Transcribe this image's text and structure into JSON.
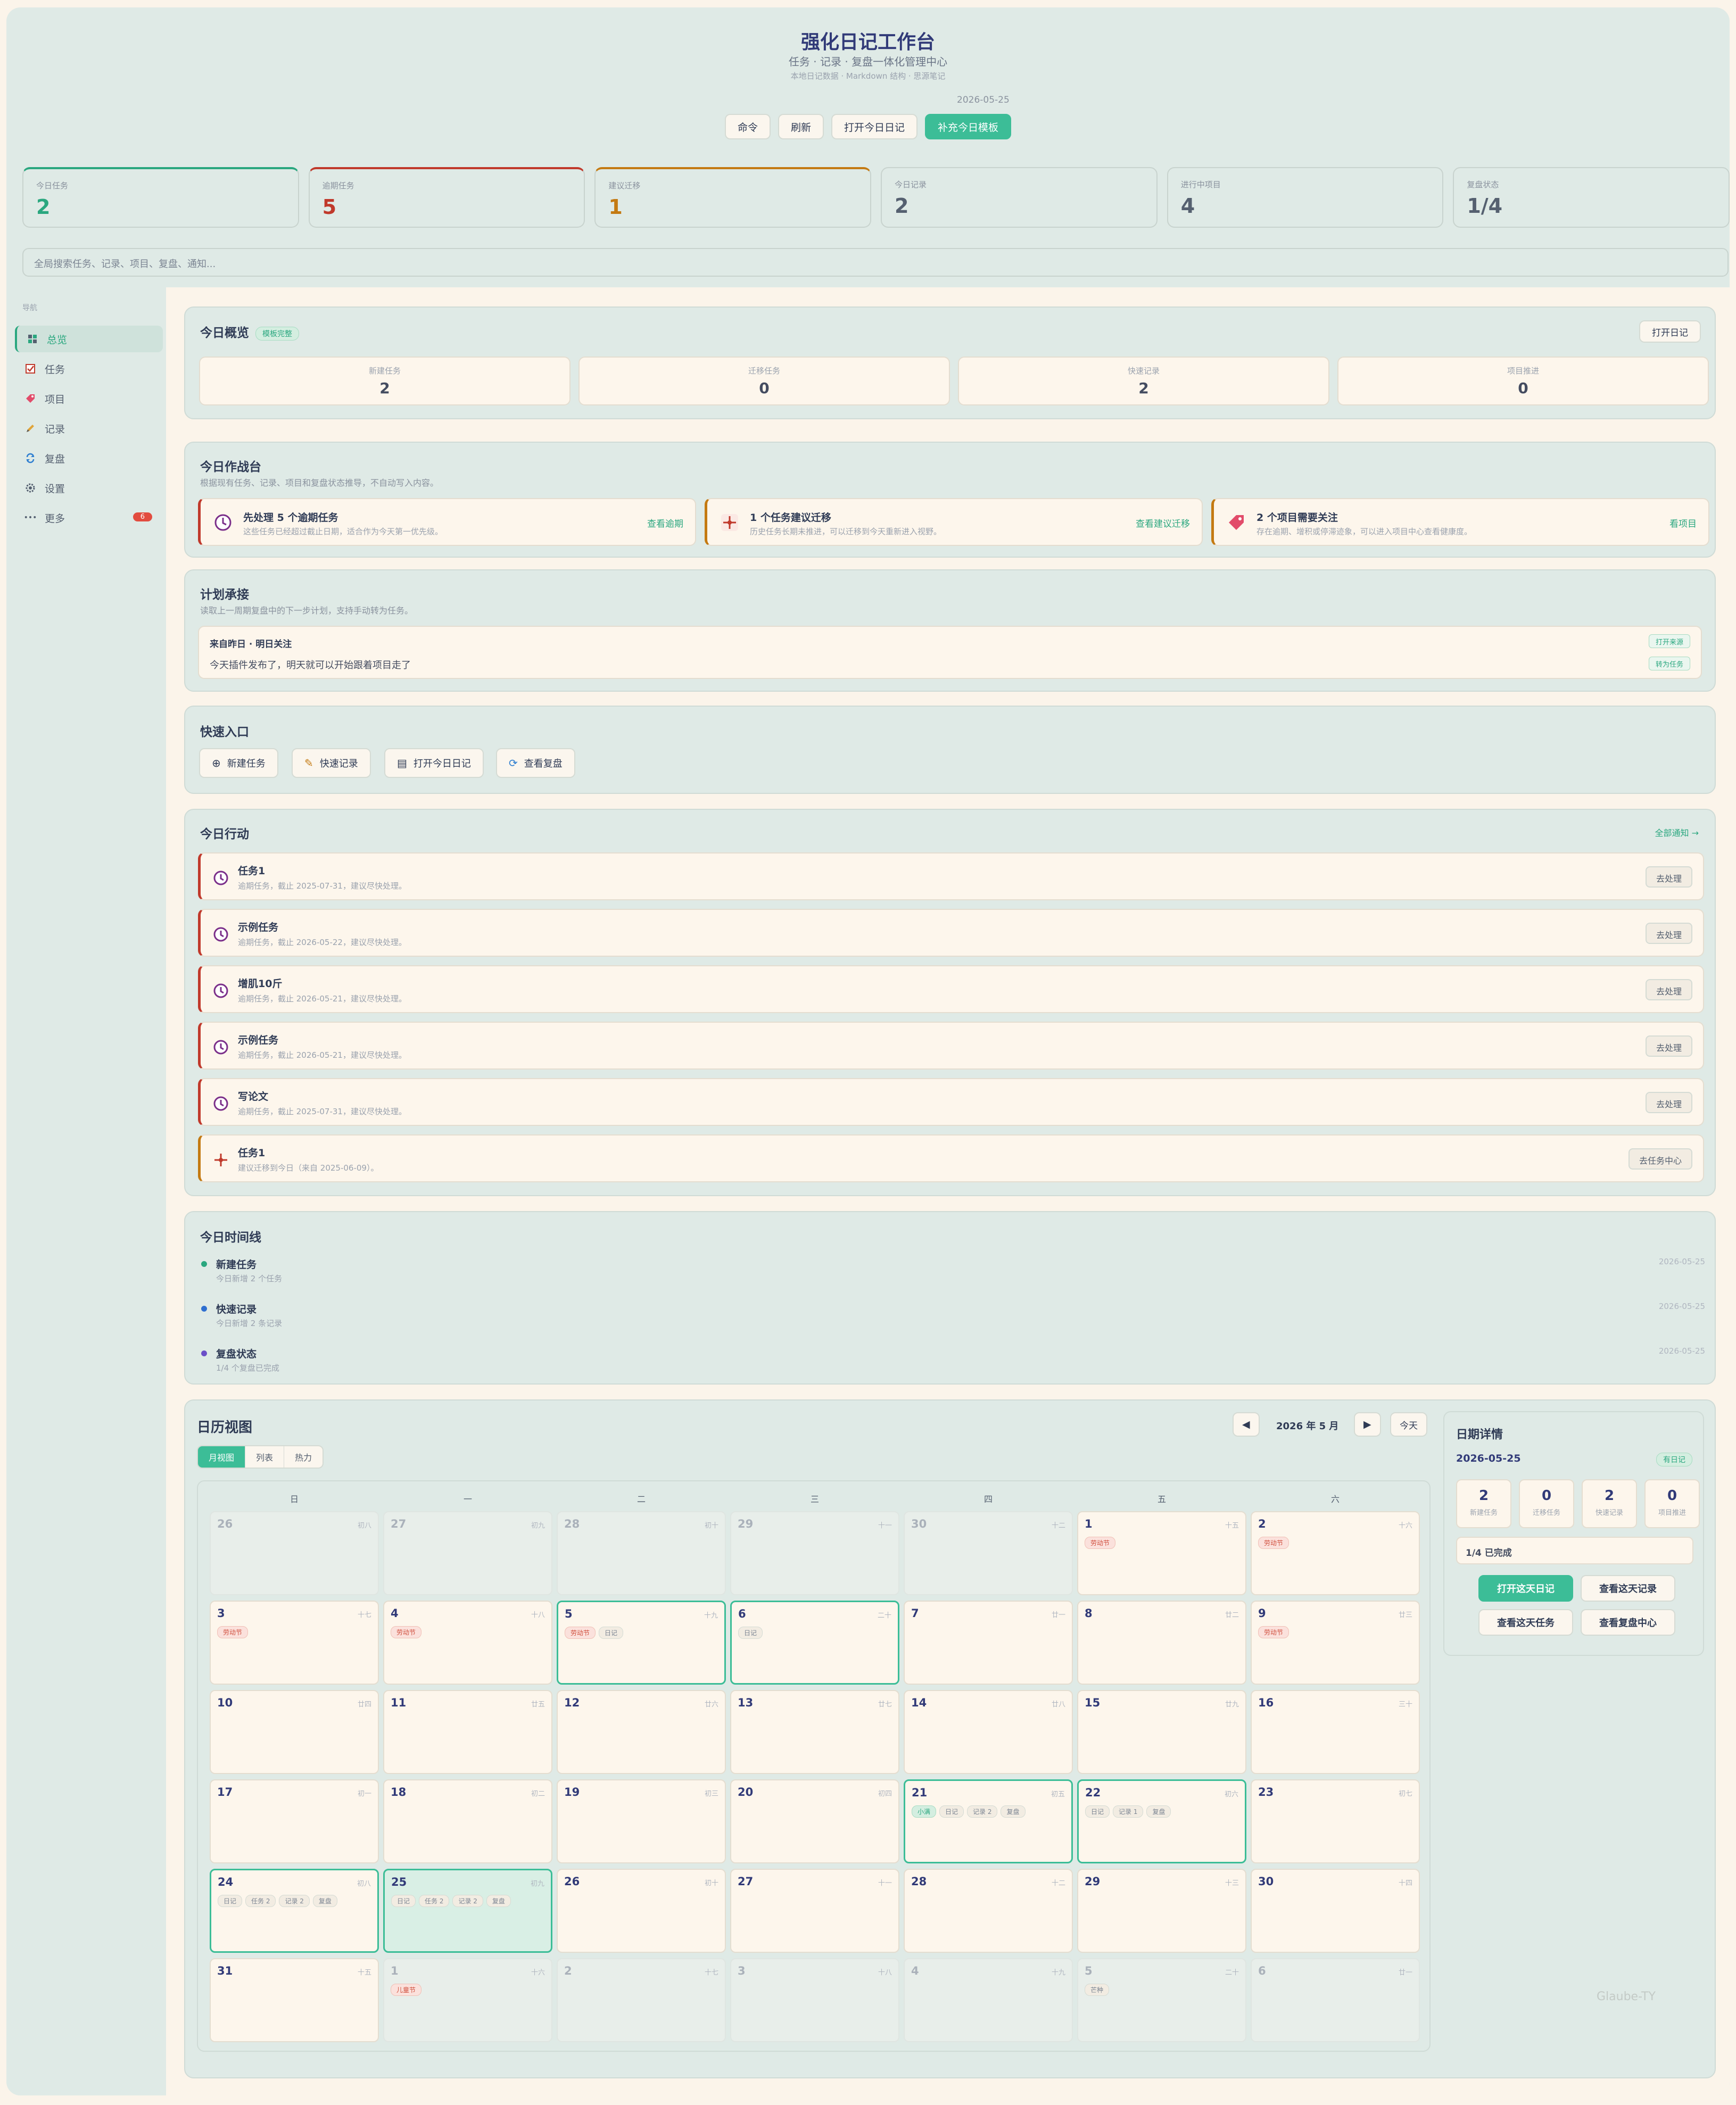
{
  "header": {
    "title": "强化日记工作台",
    "subtitle": "任务 · 记录 · 复盘一体化管理中心",
    "subtitle2": "本地日记数据 · Markdown 结构 · 思源笔记",
    "date": "2026-05-25",
    "buttons": [
      "命令",
      "刷新",
      "打开今日日记",
      "补充今日模板"
    ]
  },
  "stats": [
    {
      "label": "今日任务",
      "value": "2",
      "color": "#2aa77f"
    },
    {
      "label": "逾期任务",
      "value": "5",
      "color": "#c0392b"
    },
    {
      "label": "建议迁移",
      "value": "1",
      "color": "#c47a12"
    },
    {
      "label": "今日记录",
      "value": "2",
      "color": "#556070"
    },
    {
      "label": "进行中项目",
      "value": "4",
      "color": "#556070"
    },
    {
      "label": "复盘状态",
      "value": "1/4",
      "color": "#556070"
    }
  ],
  "search": {
    "placeholder": "全局搜索任务、记录、项目、复盘、通知..."
  },
  "sidebar": {
    "heading": "导航",
    "items": [
      {
        "label": "总览",
        "icon": "dashboard-icon"
      },
      {
        "label": "任务",
        "icon": "checkbox-icon"
      },
      {
        "label": "项目",
        "icon": "tag-icon"
      },
      {
        "label": "记录",
        "icon": "pencil-icon"
      },
      {
        "label": "复盘",
        "icon": "refresh-icon"
      },
      {
        "label": "设置",
        "icon": "gear-icon"
      },
      {
        "label": "更多",
        "icon": "dots-icon",
        "badge": "6"
      }
    ]
  },
  "overview": {
    "title": "今日概览",
    "badge": "模板完整",
    "open_btn": "打开日记",
    "boxes": [
      {
        "label": "新建任务",
        "value": "2"
      },
      {
        "label": "迁移任务",
        "value": "0"
      },
      {
        "label": "快速记录",
        "value": "2"
      },
      {
        "label": "项目推进",
        "value": "0"
      }
    ]
  },
  "battle": {
    "title": "今日作战台",
    "desc": "根据现有任务、记录、项目和复盘状态推导，不自动写入内容。",
    "items": [
      {
        "title": "先处理 5 个逾期任务",
        "desc": "这些任务已经超过截止日期，适合作为今天第一优先级。",
        "action": "查看逾期",
        "color": "#c0392b"
      },
      {
        "title": "1 个任务建议迁移",
        "desc": "历史任务长期未推进，可以迁移到今天重新进入视野。",
        "action": "查看建议迁移",
        "color": "#c47a12"
      },
      {
        "title": "2 个项目需要关注",
        "desc": "存在逾期、增积或停滞迹象，可以进入项目中心查看健康度。",
        "action": "看项目",
        "color": "#c47a12"
      }
    ]
  },
  "plan": {
    "title": "计划承接",
    "desc": "读取上一周期复盘中的下一步计划，支持手动转为任务。",
    "item_title": "来自昨日 · 明日关注",
    "item_text": "今天插件发布了，明天就可以开始跟着项目走了",
    "btn_source": "打开来源",
    "btn_task": "转为任务"
  },
  "quick": {
    "title": "快速入口",
    "buttons": [
      "新建任务",
      "快速记录",
      "打开今日日记",
      "查看复盘"
    ]
  },
  "actions": {
    "title": "今日行动",
    "all_link": "全部通知 →",
    "items": [
      {
        "title": "任务1",
        "desc": "逾期任务，截止 2025-07-31，建议尽快处理。",
        "btn": "去处理",
        "type": "overdue"
      },
      {
        "title": "示例任务",
        "desc": "逾期任务，截止 2026-05-22，建议尽快处理。",
        "btn": "去处理",
        "type": "overdue"
      },
      {
        "title": "增肌10斤",
        "desc": "逾期任务，截止 2026-05-21，建议尽快处理。",
        "btn": "去处理",
        "type": "overdue"
      },
      {
        "title": "示例任务",
        "desc": "逾期任务，截止 2026-05-21，建议尽快处理。",
        "btn": "去处理",
        "type": "overdue"
      },
      {
        "title": "写论文",
        "desc": "逾期任务，截止 2025-07-31，建议尽快处理。",
        "btn": "去处理",
        "type": "overdue"
      },
      {
        "title": "任务1",
        "desc": "建议迁移到今日（来自 2025-06-09）。",
        "btn": "去任务中心",
        "type": "migrate"
      }
    ]
  },
  "timeline": {
    "title": "今日时间线",
    "items": [
      {
        "title": "新建任务",
        "desc": "今日新增 2 个任务",
        "date": "2026-05-25",
        "color": "#2aa77f"
      },
      {
        "title": "快速记录",
        "desc": "今日新增 2 条记录",
        "date": "2026-05-25",
        "color": "#2f6fd0"
      },
      {
        "title": "复盘状态",
        "desc": "1/4 个复盘已完成",
        "date": "2026-05-25",
        "color": "#6b4fc8"
      }
    ]
  },
  "calendar": {
    "title": "日历视图",
    "month_label": "2026 年 5 月",
    "today_btn": "今天",
    "views": [
      "月视图",
      "列表",
      "热力"
    ],
    "weekdays": [
      "日",
      "一",
      "二",
      "三",
      "四",
      "五",
      "六"
    ],
    "cells": [
      {
        "d": "26",
        "lunar": "初八",
        "other": true
      },
      {
        "d": "27",
        "lunar": "初九",
        "other": true
      },
      {
        "d": "28",
        "lunar": "初十",
        "other": true
      },
      {
        "d": "29",
        "lunar": "十一",
        "other": true
      },
      {
        "d": "30",
        "lunar": "十二",
        "other": true
      },
      {
        "d": "1",
        "lunar": "十五",
        "tags": [
          "劳动节"
        ],
        "hol": true
      },
      {
        "d": "2",
        "lunar": "十六",
        "tags": [
          "劳动节"
        ],
        "hol": true
      },
      {
        "d": "3",
        "lunar": "十七",
        "tags": [
          "劳动节"
        ],
        "hol": true
      },
      {
        "d": "4",
        "lunar": "十八",
        "tags": [
          "劳动节"
        ],
        "hol": true
      },
      {
        "d": "5",
        "lunar": "十九",
        "tags": [
          "劳动节",
          "日记"
        ],
        "hol": true,
        "hl": true
      },
      {
        "d": "6",
        "lunar": "二十",
        "tags": [
          "日记"
        ],
        "hl": true
      },
      {
        "d": "7",
        "lunar": "廿一"
      },
      {
        "d": "8",
        "lunar": "廿二"
      },
      {
        "d": "9",
        "lunar": "廿三",
        "tags": [
          "劳动节"
        ],
        "hol": true
      },
      {
        "d": "10",
        "lunar": "廿四"
      },
      {
        "d": "11",
        "lunar": "廿五"
      },
      {
        "d": "12",
        "lunar": "廿六"
      },
      {
        "d": "13",
        "lunar": "廿七"
      },
      {
        "d": "14",
        "lunar": "廿八"
      },
      {
        "d": "15",
        "lunar": "廿九"
      },
      {
        "d": "16",
        "lunar": "三十"
      },
      {
        "d": "17",
        "lunar": "初一"
      },
      {
        "d": "18",
        "lunar": "初二"
      },
      {
        "d": "19",
        "lunar": "初三"
      },
      {
        "d": "20",
        "lunar": "初四"
      },
      {
        "d": "21",
        "lunar": "初五",
        "tags": [
          "小满",
          "日记",
          "记录 2",
          "复盘"
        ],
        "okfirst": true,
        "hl": true
      },
      {
        "d": "22",
        "lunar": "初六",
        "tags": [
          "日记",
          "记录 1",
          "复盘"
        ],
        "hl": true
      },
      {
        "d": "23",
        "lunar": "初七"
      },
      {
        "d": "24",
        "lunar": "初八",
        "tags": [
          "日记",
          "任务 2",
          "记录 2",
          "复盘"
        ],
        "hl": true
      },
      {
        "d": "25",
        "lunar": "初九",
        "tags": [
          "日记",
          "任务 2",
          "记录 2",
          "复盘"
        ],
        "today": true
      },
      {
        "d": "26",
        "lunar": "初十"
      },
      {
        "d": "27",
        "lunar": "十一"
      },
      {
        "d": "28",
        "lunar": "十二"
      },
      {
        "d": "29",
        "lunar": "十三"
      },
      {
        "d": "30",
        "lunar": "十四"
      },
      {
        "d": "31",
        "lunar": "十五"
      },
      {
        "d": "1",
        "lunar": "十六",
        "other": true,
        "tags": [
          "儿童节"
        ],
        "hol": true
      },
      {
        "d": "2",
        "lunar": "十七",
        "other": true
      },
      {
        "d": "3",
        "lunar": "十八",
        "other": true
      },
      {
        "d": "4",
        "lunar": "十九",
        "other": true
      },
      {
        "d": "5",
        "lunar": "二十",
        "other": true,
        "tags": [
          "芒种"
        ]
      },
      {
        "d": "6",
        "lunar": "廿一",
        "other": true
      }
    ],
    "detail": {
      "title": "日期详情",
      "date": "2026-05-25",
      "badge": "有日记",
      "boxes": [
        {
          "value": "2",
          "label": "新建任务"
        },
        {
          "value": "0",
          "label": "迁移任务"
        },
        {
          "value": "2",
          "label": "快速记录"
        },
        {
          "value": "0",
          "label": "项目推进"
        }
      ],
      "review": "1/4 已完成",
      "buttons": [
        "打开这天日记",
        "查看这天记录",
        "查看这天任务",
        "查看复盘中心"
      ]
    },
    "watermark": "Glaube-TY"
  }
}
